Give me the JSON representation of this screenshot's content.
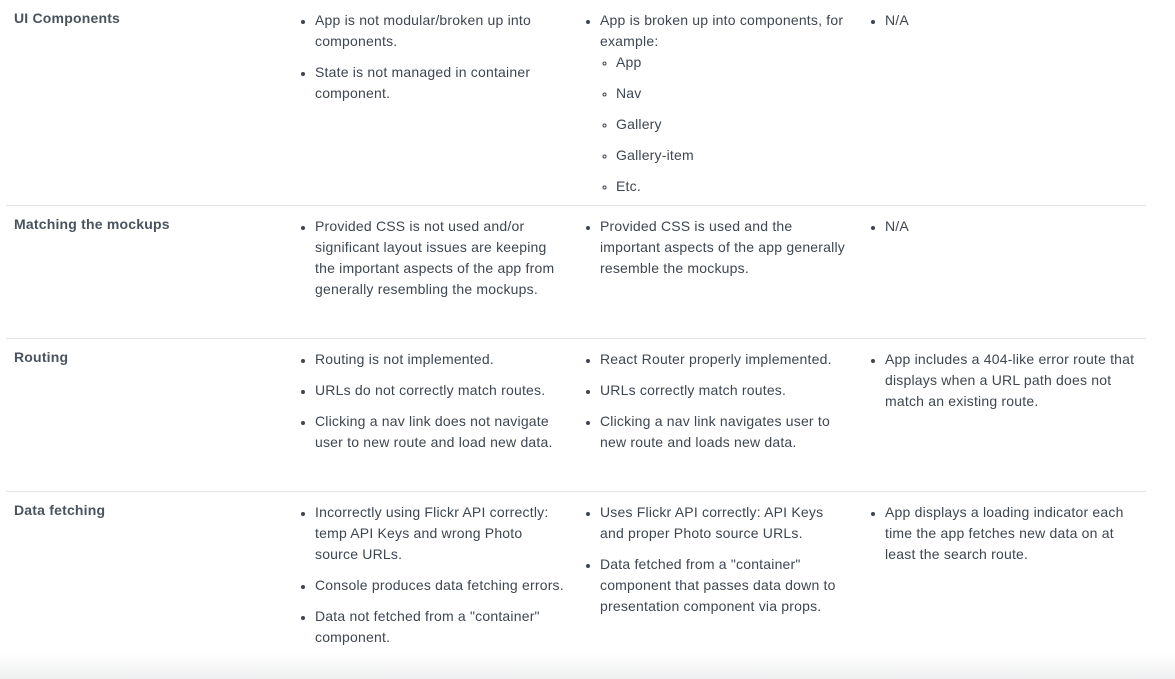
{
  "rows": [
    {
      "title": "UI Components",
      "col1": [
        "App is not modular/broken up into components.",
        "State is not managed in container component."
      ],
      "col2": {
        "intro": "App is broken up into components, for example:",
        "examples": [
          "App",
          "Nav",
          "Gallery",
          "Gallery-item",
          "Etc."
        ]
      },
      "col3": [
        "N/A"
      ]
    },
    {
      "title": "Matching the mockups",
      "col1": [
        "Provided CSS is not used and/or significant layout issues are keeping the important aspects of the app from generally resembling the mockups."
      ],
      "col2": [
        "Provided CSS is used and the important aspects of the app generally resemble the mockups."
      ],
      "col3": [
        "N/A"
      ]
    },
    {
      "title": "Routing",
      "col1": [
        "Routing is not implemented.",
        "URLs do not correctly match routes.",
        "Clicking a nav link does not navigate user to new route and load new data."
      ],
      "col2": [
        "React Router properly implemented.",
        "URLs correctly match routes.",
        "Clicking a nav link navigates user to new route and loads new data."
      ],
      "col3": [
        "App includes a 404-like error route that displays when a URL path does not match an existing route."
      ]
    },
    {
      "title": "Data fetching",
      "col1": [
        "Incorrectly using Flickr API correctly: temp API Keys and wrong Photo source URLs.",
        "Console produces data fetching errors.",
        "Data not fetched from a \"container\" component."
      ],
      "col2": [
        "Uses Flickr API correctly: API Keys and proper Photo source URLs.",
        "Data fetched from a \"container\" component that passes data down to presentation component via props."
      ],
      "col3": [
        "App displays a loading indicator each time the app fetches new data on at least the search route."
      ]
    }
  ]
}
